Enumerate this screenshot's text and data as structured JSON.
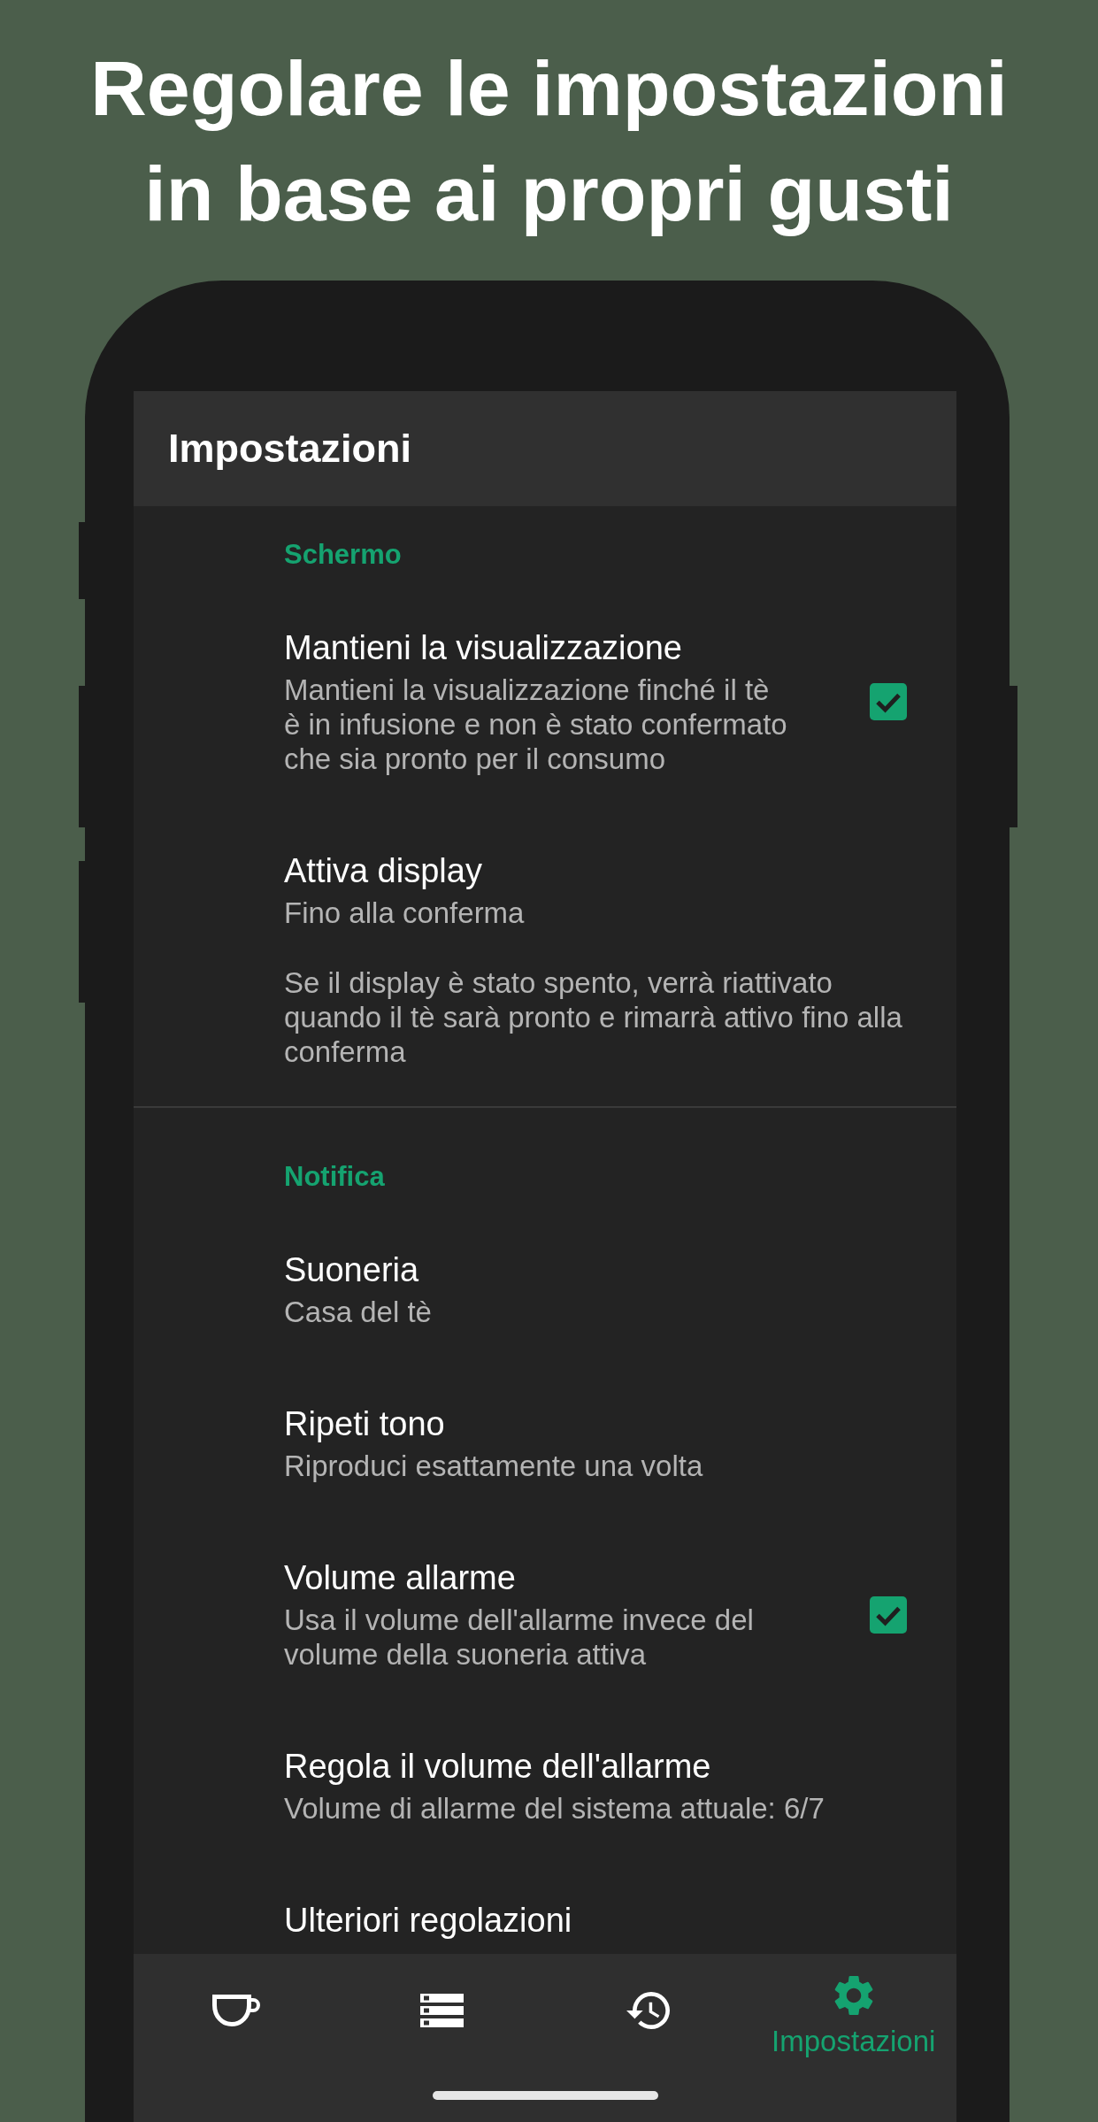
{
  "headline": [
    "Regolare le impostazioni",
    "in base ai propri gusti"
  ],
  "app_bar": {
    "title": "Impostazioni"
  },
  "sections": [
    {
      "title": "Schermo",
      "items": [
        {
          "kind": "checkbox",
          "title": "Mantieni la visualizzazione",
          "summary": "Mantieni la visualizzazione finché il tè è in infusione e non è stato confermato che sia pronto per il consumo",
          "checked": true
        },
        {
          "kind": "text",
          "title": "Attiva display",
          "summary": "Fino alla conferma",
          "note": "Se il display è stato spento, verrà riattivato quando il tè sarà pronto e rimarrà attivo fino alla conferma"
        }
      ]
    },
    {
      "title": "Notifica",
      "items": [
        {
          "kind": "text",
          "title": "Suoneria",
          "summary": "Casa del tè"
        },
        {
          "kind": "text",
          "title": "Ripeti tono",
          "summary": "Riproduci esattamente una volta"
        },
        {
          "kind": "checkbox",
          "title": "Volume allarme",
          "summary": "Usa il volume dell'allarme invece del volume della suoneria attiva",
          "checked": true
        },
        {
          "kind": "text",
          "title": "Regola il volume dell'allarme",
          "summary": "Volume di allarme del sistema attuale: 6/7"
        },
        {
          "kind": "text",
          "title": "Ulteriori regolazioni"
        }
      ]
    }
  ],
  "bottom_nav": {
    "items": [
      {
        "selected": false
      },
      {
        "selected": false
      },
      {
        "selected": false
      },
      {
        "label": "Impostazioni",
        "selected": true
      }
    ]
  }
}
